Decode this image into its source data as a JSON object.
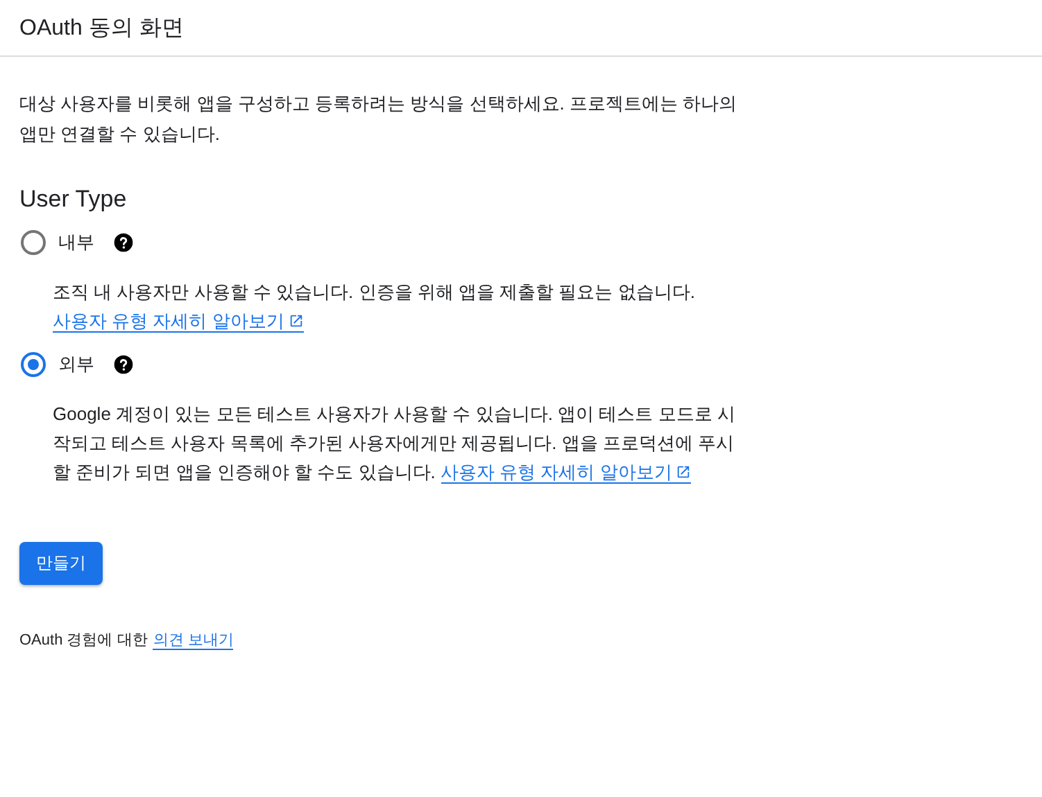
{
  "header": {
    "title": "OAuth 동의 화면"
  },
  "intro": "대상 사용자를 비롯해 앱을 구성하고 등록하려는 방식을 선택하세요. 프로젝트에는 하나의 앱만 연결할 수 있습니다.",
  "section_title": "User Type",
  "options": [
    {
      "label": "내부",
      "selected": false,
      "description": "조직 내 사용자만 사용할 수 있습니다. 인증을 위해 앱을 제출할 필요는 없습니다.",
      "link": "사용자 유형 자세히 알아보기"
    },
    {
      "label": "외부",
      "selected": true,
      "description": "Google 계정이 있는 모든 테스트 사용자가 사용할 수 있습니다. 앱이 테스트 모드로 시작되고 테스트 사용자 목록에 추가된 사용자에게만 제공됩니다. 앱을 프로덕션에 푸시할 준비가 되면 앱을 인증해야 할 수도 있습니다.",
      "link": "사용자 유형 자세히 알아보기"
    }
  ],
  "create_button": "만들기",
  "footer": {
    "text": "OAuth 경험에 대한",
    "link": "의견 보내기"
  }
}
